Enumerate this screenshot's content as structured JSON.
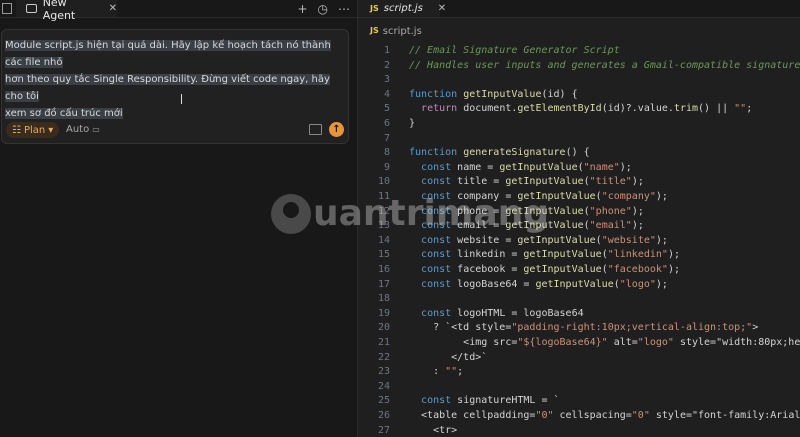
{
  "left_tab": {
    "title": "New Agent"
  },
  "composer": {
    "prompt_line1": "Module script.js hiện tại quá dài. Hãy lập kế hoạch tách nó thành các file nhỏ",
    "prompt_line2": "hơn theo quy tắc Single Responsibility. Đừng viết code ngay, hãy cho tôi",
    "prompt_line3": "xem sơ đồ cấu trúc mới",
    "mode": "Plan",
    "model": "Auto"
  },
  "editor": {
    "tab": "script.js",
    "breadcrumb": "script.js",
    "badge": "JS",
    "lines": [
      {
        "n": "1",
        "t": "// Email Signature Generator Script"
      },
      {
        "n": "2",
        "t": "// Handles user inputs and generates a Gmail-compatible signature"
      },
      {
        "n": "3",
        "t": ""
      },
      {
        "n": "4",
        "t": "function getInputValue(id) {"
      },
      {
        "n": "5",
        "t": "  return document.getElementById(id)?.value.trim() || \"\";"
      },
      {
        "n": "6",
        "t": "}"
      },
      {
        "n": "7",
        "t": ""
      },
      {
        "n": "8",
        "t": "function generateSignature() {"
      },
      {
        "n": "9",
        "t": "  const name = getInputValue(\"name\");"
      },
      {
        "n": "10",
        "t": "  const title = getInputValue(\"title\");"
      },
      {
        "n": "11",
        "t": "  const company = getInputValue(\"company\");"
      },
      {
        "n": "12",
        "t": "  const phone = getInputValue(\"phone\");"
      },
      {
        "n": "13",
        "t": "  const email = getInputValue(\"email\");"
      },
      {
        "n": "14",
        "t": "  const website = getInputValue(\"website\");"
      },
      {
        "n": "15",
        "t": "  const linkedin = getInputValue(\"linkedin\");"
      },
      {
        "n": "16",
        "t": "  const facebook = getInputValue(\"facebook\");"
      },
      {
        "n": "17",
        "t": "  const logoBase64 = getInputValue(\"logo\");"
      },
      {
        "n": "18",
        "t": ""
      },
      {
        "n": "19",
        "t": "  const logoHTML = logoBase64"
      },
      {
        "n": "20",
        "t": "    ? `<td style=\"padding-right:10px;vertical-align:top;\">"
      },
      {
        "n": "21",
        "t": "         <img src=\"${logoBase64}\" alt=\"logo\" style=\"width:80px;hei"
      },
      {
        "n": "22",
        "t": "       </td>`"
      },
      {
        "n": "23",
        "t": "    : \"\";"
      },
      {
        "n": "24",
        "t": ""
      },
      {
        "n": "25",
        "t": "  const signatureHTML = `"
      },
      {
        "n": "26",
        "t": "  <table cellpadding=\"0\" cellspacing=\"0\" style=\"font-family:Arial,"
      },
      {
        "n": "27",
        "t": "    <tr>"
      }
    ]
  },
  "watermark": "uantrimang"
}
